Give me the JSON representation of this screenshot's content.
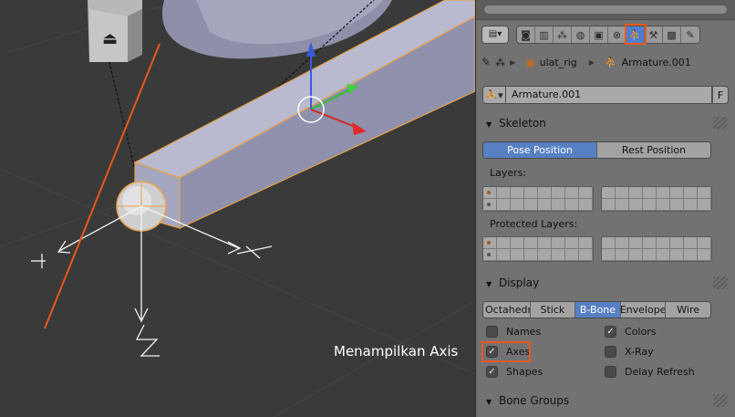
{
  "annotation": {
    "text": "Menampilkan Axis"
  },
  "context": {
    "path_object": "ulat_rig",
    "path_data": "Armature.001"
  },
  "datablock": {
    "name_value": "Armature.001",
    "fake_user_label": "F"
  },
  "skeleton": {
    "title": "Skeleton",
    "pose_button": "Pose Position",
    "rest_button": "Rest Position",
    "layers_label": "Layers:",
    "protected_label": "Protected Layers:"
  },
  "display": {
    "title": "Display",
    "modes": [
      "Octahedral",
      "Stick",
      "B-Bone",
      "Envelope",
      "Wire"
    ],
    "active_mode": "B-Bone",
    "names_label": "Names",
    "axes_label": "Axes",
    "shapes_label": "Shapes",
    "colors_label": "Colors",
    "xray_label": "X-Ray",
    "delay_label": "Delay Refresh"
  },
  "bone_groups": {
    "title": "Bone Groups"
  },
  "colors": {
    "accent": "#5680c2",
    "highlight": "#e8591a",
    "panel_bg": "#727272",
    "viewport_bg": "#3a3a3a"
  }
}
